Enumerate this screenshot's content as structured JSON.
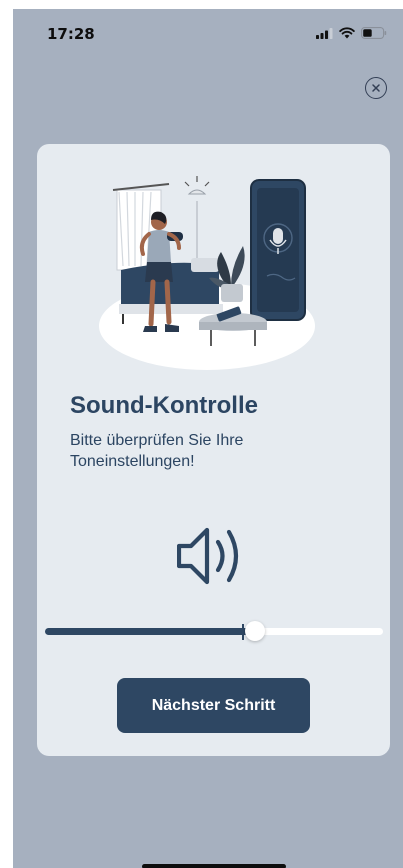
{
  "status_bar": {
    "time": "17:28"
  },
  "dialog": {
    "title": "Sound-Kontrolle",
    "subtitle": "Bitte überprüfen Sie Ihre Toneinstellungen!",
    "next_button_label": "Nächster Schritt",
    "volume_fraction": 0.62
  },
  "icons": {
    "close": "close-icon",
    "speaker": "speaker-icon",
    "signal": "signal-icon",
    "wifi": "wifi-icon",
    "battery": "battery-icon"
  },
  "colors": {
    "background": "#a6b0bf",
    "card": "#e6ebf0",
    "accent": "#2e4763",
    "text": "#2c4562"
  }
}
